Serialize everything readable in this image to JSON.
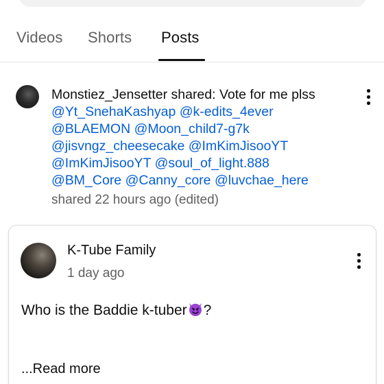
{
  "tabs": [
    {
      "label": "Videos",
      "active": false
    },
    {
      "label": "Shorts",
      "active": false
    },
    {
      "label": "Posts",
      "active": true
    }
  ],
  "shared_post": {
    "author": "Monstiez_Jensetter shared:",
    "text": "Vote for me plss",
    "mentions": [
      "@Yt_SnehaKashyap",
      "@k-edits_4ever",
      "@BLAEMON",
      "@Moon_child7-g7k",
      "@jisvngz_cheesecake",
      "@ImKimJisooYT",
      "@ImKimJisooYT",
      "@soul_of_light.888",
      "@BM_Core",
      "@Canny_core",
      "@luvchae_here"
    ],
    "meta": "shared 22 hours ago (edited)",
    "menu_icon": "more-vert-icon"
  },
  "card": {
    "channel": "K-Tube Family",
    "time": "1 day ago",
    "body": "Who is the Baddie k-tuber",
    "body_suffix": "?",
    "emoji_icon": "smiling-devil-icon",
    "read_more": "...Read more",
    "menu_icon": "more-vert-icon"
  },
  "colors": {
    "mention": "#065fd4",
    "secondary_text": "#606060",
    "primary_text": "#0f0f0f"
  }
}
